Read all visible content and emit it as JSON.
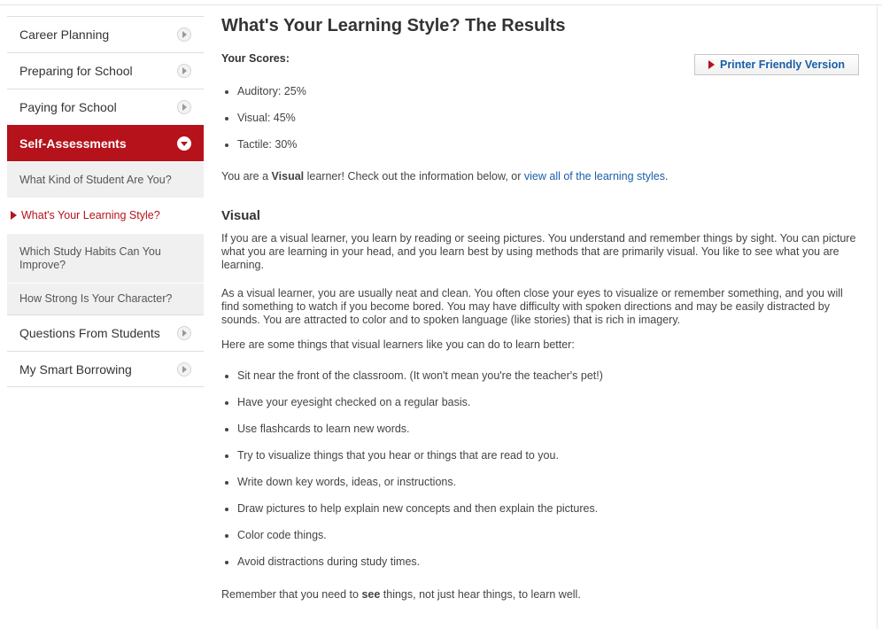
{
  "sidebar": {
    "top_items": [
      {
        "label": "Career Planning"
      },
      {
        "label": "Preparing for School"
      },
      {
        "label": "Paying for School"
      }
    ],
    "active_item": {
      "label": "Self-Assessments"
    },
    "sub_items": [
      {
        "label": "What Kind of Student Are You?"
      },
      {
        "label": "What's Your Learning Style?"
      },
      {
        "label": "Which Study Habits Can You Improve?"
      },
      {
        "label": "How Strong Is Your Character?"
      }
    ],
    "bottom_items": [
      {
        "label": "Questions From Students"
      },
      {
        "label": "My Smart Borrowing"
      }
    ]
  },
  "page": {
    "title": "What's Your Learning Style? The Results",
    "scores_label": "Your Scores:",
    "printer_button": "Printer Friendly Version",
    "scores": [
      "Auditory: 25%",
      "Visual: 45%",
      "Tactile: 30%"
    ],
    "result": {
      "prefix": "You are a ",
      "style": "Visual",
      "middle": " learner! Check out the information below, or ",
      "link": "view all of the learning styles",
      "suffix": "."
    },
    "section_title": "Visual",
    "paragraphs": [
      "If you are a visual learner, you learn by reading or seeing pictures. You understand and remember things by sight. You can picture what you are learning in your head, and you learn best by using methods that are primarily visual. You like to see what you are learning.",
      "As a visual learner, you are usually neat and clean. You often close your eyes to visualize or remember something, and you will find something to watch if you become bored. You may have difficulty with spoken directions and may be easily distracted by sounds. You are attracted to color and to spoken language (like stories) that is rich in imagery.",
      "Here are some things that visual learners like you can do to learn better:"
    ],
    "tips": [
      "Sit near the front of the classroom. (It won't mean you're the teacher's pet!)",
      "Have your eyesight checked on a regular basis.",
      "Use flashcards to learn new words.",
      "Try to visualize things that you hear or things that are read to you.",
      "Write down key words, ideas, or instructions.",
      "Draw pictures to help explain new concepts and then explain the pictures.",
      "Color code things.",
      "Avoid distractions during study times."
    ],
    "closing": {
      "prefix": "Remember that you need to ",
      "emphasis": "see",
      "suffix": " things, not just hear things, to learn well."
    }
  },
  "colors": {
    "accent": "#b5121b",
    "link": "#1a5ea8",
    "text": "#444444",
    "sub_item_bg": "#f0f0f0"
  }
}
